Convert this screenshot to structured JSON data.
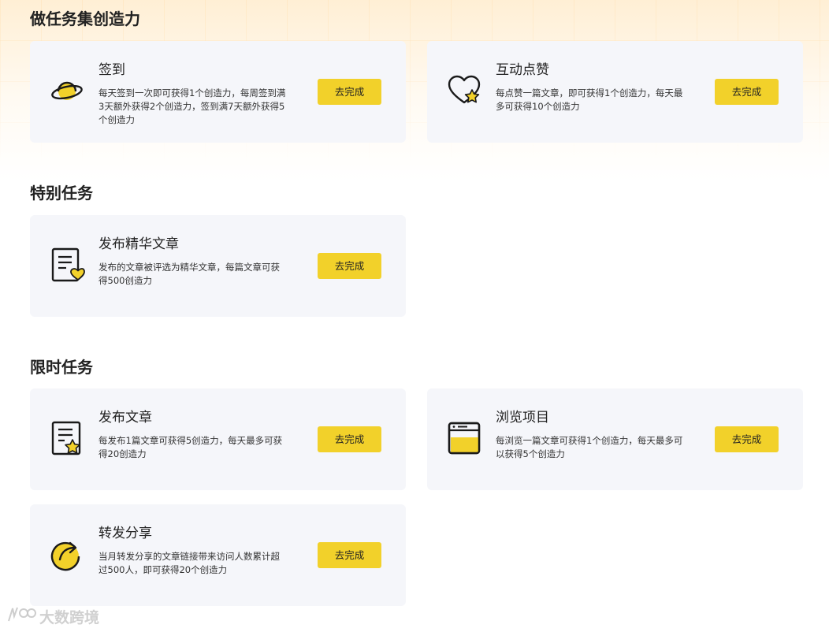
{
  "sections": [
    {
      "title": "做任务集创造力"
    },
    {
      "title": "特别任务"
    },
    {
      "title": "限时任务"
    }
  ],
  "cards": [
    {
      "icon": "planet-icon",
      "title": "签到",
      "desc": "每天签到一次即可获得1个创造力，每周签到满3天额外获得2个创造力，签到满7天额外获得5个创造力",
      "button": "去完成"
    },
    {
      "icon": "heart-star-icon",
      "title": "互动点赞",
      "desc": "每点赞一篇文章，即可获得1个创造力，每天最多可获得10个创造力",
      "button": "去完成"
    },
    {
      "icon": "document-heart-icon",
      "title": "发布精华文章",
      "desc": "发布的文章被评选为精华文章，每篇文章可获得500创造力",
      "button": "去完成"
    },
    {
      "icon": "document-star-icon",
      "title": "发布文章",
      "desc": "每发布1篇文章可获得5创造力，每天最多可获得20创造力",
      "button": "去完成"
    },
    {
      "icon": "browser-window-icon",
      "title": "浏览项目",
      "desc": "每浏览一篇文章可获得1个创造力，每天最多可以获得5个创造力",
      "button": "去完成"
    },
    {
      "icon": "share-arrow-icon",
      "title": "转发分享",
      "desc": "当月转发分享的文章链接带来访问人数累计超过500人，即可获得20个创造力",
      "button": "去完成"
    }
  ],
  "watermark": {
    "text": "大数跨境"
  },
  "colors": {
    "accent": "#f2d12a",
    "card_bg": "#f5f6fa",
    "icon_stroke": "#1a1a1a"
  }
}
